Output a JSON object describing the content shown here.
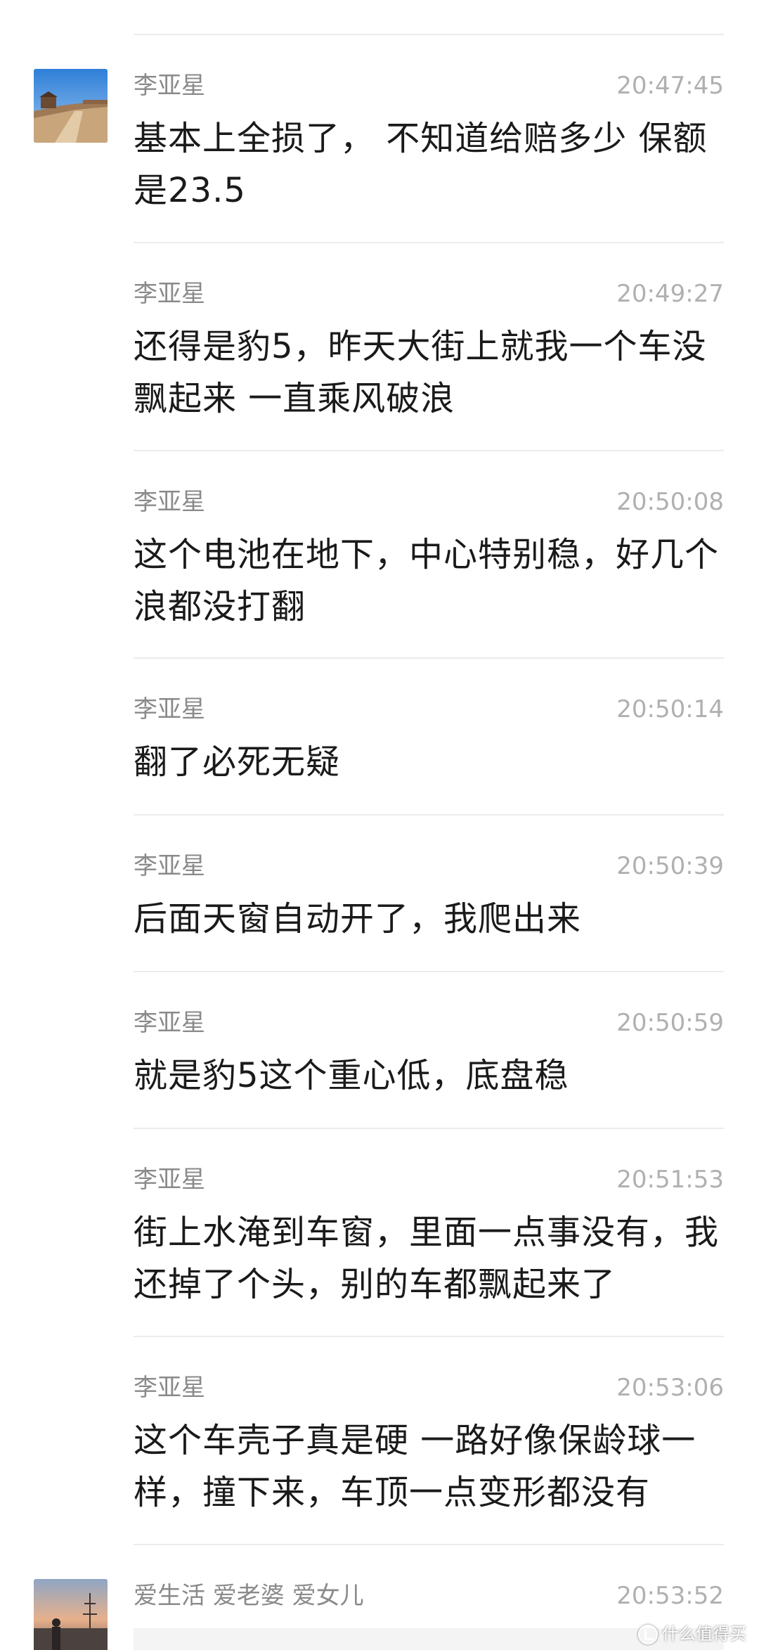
{
  "messages": [
    {
      "sender": "李亚星",
      "time": "20:47:45",
      "text": "基本上全损了， 不知道给赔多少 保额是23.5"
    },
    {
      "sender": "李亚星",
      "time": "20:49:27",
      "text": "还得是豹5，昨天大街上就我一个车没飘起来  一直乘风破浪"
    },
    {
      "sender": "李亚星",
      "time": "20:50:08",
      "text": "这个电池在地下，中心特别稳，好几个浪都没打翻"
    },
    {
      "sender": "李亚星",
      "time": "20:50:14",
      "text": "翻了必死无疑"
    },
    {
      "sender": "李亚星",
      "time": "20:50:39",
      "text": "后面天窗自动开了，我爬出来"
    },
    {
      "sender": "李亚星",
      "time": "20:50:59",
      "text": "就是豹5这个重心低，底盘稳"
    },
    {
      "sender": "李亚星",
      "time": "20:51:53",
      "text": "街上水淹到车窗，里面一点事没有，我还掉了个头，别的车都飘起来了"
    },
    {
      "sender": "李亚星",
      "time": "20:53:06",
      "text": "这个车壳子真是硬 一路好像保龄球一样，撞下来，车顶一点变形都没有"
    }
  ],
  "last_message": {
    "sender": "爱生活 爱老婆  爱女儿",
    "time": "20:53:52"
  },
  "watermark": "什么值得买",
  "colors": {
    "sender": "#8a8a8a",
    "time": "#b0b0b0",
    "text": "#1a1a1a",
    "divider": "#ececec"
  }
}
